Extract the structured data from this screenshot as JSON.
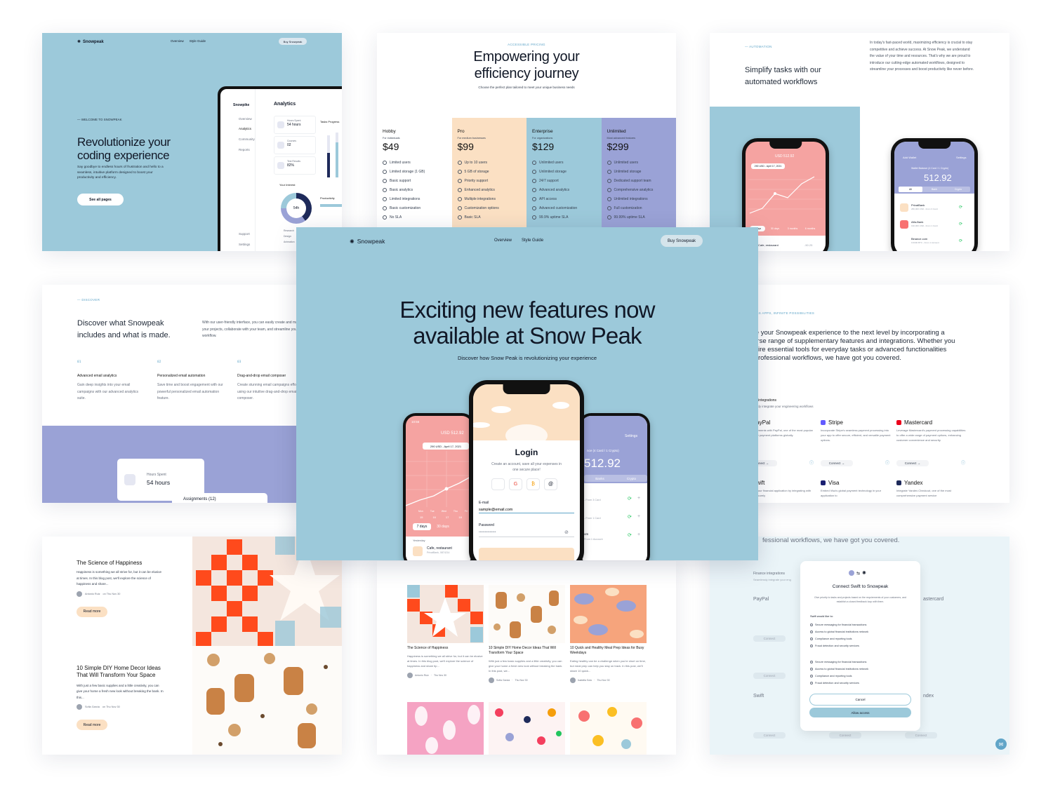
{
  "colors": {
    "blue": "#9cc9da",
    "peach": "#fbe0c3",
    "lavender": "#9aa2d6",
    "coral": "#f5a3a1",
    "dark": "#111827"
  },
  "hero_card": {
    "logo": "Snowpeak",
    "nav": [
      "Overview",
      "Style Guide"
    ],
    "cta": "Buy Snowpeak",
    "eyebrow": "— WELCOME TO SNOWPEAK",
    "title_l1": "Revolutionize your",
    "title_l2": "coding experience",
    "subtitle": "Say goodbye to endless hours of frustration and hello to a seamless, intuitive platform designed to boost your productivity and efficiency.",
    "button": "See all pages",
    "app": {
      "brand": "Snowpike",
      "title": "Analytics",
      "menu": [
        "Overview",
        "Analytics",
        "Community",
        "Reports"
      ],
      "footer": [
        "Support",
        "Settings"
      ],
      "stats": [
        {
          "label": "Hours Spent",
          "value": "54 hours"
        },
        {
          "label": "Courses",
          "value": "02"
        },
        {
          "label": "Test Results",
          "value": "82%"
        }
      ],
      "tasks_title": "Tasks Progress",
      "interest_title": "Your Interest",
      "donut_value": "54h",
      "legend": [
        "Research",
        "Design",
        "Animation"
      ],
      "productivity": "Productivity"
    }
  },
  "pricing": {
    "eyebrow": "ACCESSIBLE PRICING",
    "title_l1": "Empowering your",
    "title_l2": "efficiency journey",
    "subtitle": "Choose the perfect plan tailored to meet your unique business needs",
    "plans": [
      {
        "name": "Hobby",
        "for": "For individuals",
        "price": "$49",
        "features": [
          "Limited users",
          "Limited storage (1 GB)",
          "Basic support",
          "Basic analytics",
          "Limited integrations",
          "Basic customization",
          "No SLA"
        ]
      },
      {
        "name": "Pro",
        "for": "For medium businesses",
        "price": "$99",
        "features": [
          "Up to 10 users",
          "5 GB of storage",
          "Priority support",
          "Enhanced analytics",
          "Multiple integrations",
          "Customization options",
          "Basic SLA"
        ]
      },
      {
        "name": "Enterprise",
        "for": "For organizations",
        "price": "$129",
        "features": [
          "Unlimited users",
          "Unlimited storage",
          "24/7 support",
          "Advanced analytics",
          "API access",
          "Advanced customization",
          "99.9% uptime SLA"
        ]
      },
      {
        "name": "Unlimited",
        "for": "Most advanced features",
        "price": "$299",
        "features": [
          "Unlimited users",
          "Unlimited storage",
          "Dedicated support team",
          "Comprehensive analytics",
          "Unlimited integrations",
          "Full customization",
          "99.99% uptime SLA"
        ]
      }
    ]
  },
  "automation": {
    "eyebrow": "— AUTOMATION",
    "title_l1": "Simplify tasks with our",
    "title_l2": "automated workflows",
    "body": "In today's fast-paced world, maximizing efficiency is crucial to stay competitive and achieve success. At Snow Peak, we understand the value of your time and resources. That's why we are proud to introduce our cutting-edge automated workflows, designed to streamline your processes and boost productivity like never before.",
    "phone1": {
      "amount": "USD 512.92",
      "tooltip": "290 USD - April 17, 2021",
      "tabs": [
        "7 days",
        "30 days",
        "3 months",
        "6 months"
      ],
      "item": "Cafe, restaurant",
      "item_amt": "-50.25"
    },
    "phone2": {
      "header": "Add Wallet",
      "settings": "Settings",
      "label": "Wallet Balance (4 Card / 1 Crypto)",
      "amount": "512.92",
      "tabs": [
        "All",
        "Bank",
        "Crypto"
      ],
      "items": [
        {
          "name": "PrivatBank",
          "sub": "280,000 USD - From 3 Card"
        },
        {
          "name": "Alfa-Bank",
          "sub": "190,000 USD - From 1 Card"
        },
        {
          "name": "Binance.com",
          "sub": "0.6000 BTC - From 1 Account"
        }
      ]
    }
  },
  "discover": {
    "eyebrow": "— DISCOVER",
    "title_l1": "Discover what Snowpeak",
    "title_l2": "includes and what is made.",
    "body": "With our user-friendly interface, you can easily create and manage your projects, collaborate with your team, and streamline your workflow.",
    "features": [
      {
        "num": "01",
        "title": "Advanced email analytics",
        "desc": "Gain deep insights into your email campaigns with our advanced analytics suite."
      },
      {
        "num": "02",
        "title": "Personalized email automation",
        "desc": "Save time and boost engagement with our powerful personalized email automation feature."
      },
      {
        "num": "03",
        "title": "Drag-and-drop email composer",
        "desc": "Create stunning email campaigns effortlessly using our intuitive drag-and-drop email composer."
      }
    ],
    "stat_label": "Hours Spent",
    "stat_value": "54 hours",
    "assign": "Assignments (12)"
  },
  "integrations": {
    "eyebrow": "ENDLESS APPS, INFINITE POSSIBILITIES",
    "body": "Take your Snowpeak experience to the next level by incorporating a diverse range of supplementary features and integrations. Whether you require essential tools for everyday tasks or advanced functionalities for professional workflows, we have got you covered.",
    "section": "Finance integrations",
    "section_sub": "Seamlessly integrate your engineering workflows",
    "connect": "Connect",
    "items": [
      {
        "name": "PayPal",
        "desc": "Accept payments with PayPal, one of the most popular and secure payment platforms globally."
      },
      {
        "name": "Stripe",
        "desc": "Incorporate Stripe's seamless payment processing into your app to offer secure, efficient, and versatile payment options."
      },
      {
        "name": "Mastercard",
        "desc": "Leverage Mastercard's payment processing capabilities to offer a wide range of payment options, enhancing customer convenience and security."
      },
      {
        "name": "Swift",
        "desc": "Enhance your financial application by integrating with Swift to securely"
      },
      {
        "name": "Visa",
        "desc": "Embed Visa's global payment technology in your application to"
      },
      {
        "name": "Yandex",
        "desc": "Integrate Yandex.Checkout, one of the most comprehensive payment service"
      }
    ]
  },
  "featured": {
    "logo": "Snowpeak",
    "nav": [
      "Overview",
      "Style Guide"
    ],
    "cta": "Buy Snowpeak",
    "title_l1": "Exciting new features now",
    "title_l2": "available at Snow Peak",
    "subtitle": "Discover how Snow Peak is revolutionizing your experience",
    "login": {
      "title": "Login",
      "sub": "Create an account, save all your expenses in one secure place!",
      "email_label": "E-mail",
      "email_value": "sample@email.com",
      "password_label": "Password",
      "password_value": "••••••••••••••"
    },
    "left_phone": {
      "time": "10:56",
      "amount": "USD 512.92",
      "tooltip": "290 USD - April 17, 2021",
      "days": [
        "Mon",
        "Tue",
        "Wed",
        "Thu",
        "Fri"
      ],
      "dates": [
        "15",
        "16",
        "17",
        "18",
        "19"
      ],
      "tabs": [
        "7 days",
        "30 days"
      ],
      "yesterday": "Yesterday",
      "item": "Cafe, restaurant",
      "item_sub": "PrivatBank, 0874214"
    },
    "right_phone": {
      "settings": "Settings",
      "label": "nce (4 Card / 1 Crypto)",
      "amount": "512.92",
      "tabs": [
        "Banks",
        "Crypto"
      ],
      "rows": [
        "- From 3 Card",
        "- From 1 Card",
        "om",
        "From 1 Account"
      ]
    }
  },
  "blog": {
    "posts": [
      {
        "title": "The Science of Happiness",
        "excerpt": "Happiness is something we all strive for, but it can be elusive at times. In this blog post, we'll explore the science of happiness and share...",
        "author": "Antonio Ruiz",
        "date": "on Thu Nov 30",
        "button": "Read more"
      },
      {
        "title": "10 Simple DIY Home Decor Ideas That Will Transform Your Space",
        "excerpt": "With just a few basic supplies and a little creativity, you can give your home a fresh new look without breaking the bank. In this...",
        "author": "Sofia Garcia",
        "date": "on Thu Nov 30",
        "button": "Read more"
      }
    ]
  },
  "blog_grid": {
    "posts": [
      {
        "title": "The Science of Happiness",
        "excerpt": "Happiness is something we all strive for, but it can be elusive at times. In this blog post, we'll explore the science of happiness and share tip...",
        "author": "Antonio Ruiz",
        "date": "Thu Nov 30"
      },
      {
        "title": "10 Simple DIY Home Decor Ideas That Will Transform Your Space",
        "excerpt": "With just a few basic supplies and a little creativity, you can give your home a fresh new look without breaking the bank. In this post, we...",
        "author": "Sofia Garcia",
        "date": "Thu Nov 30"
      },
      {
        "title": "10 Quick and Healthy Meal Prep Ideas for Busy Weekdays",
        "excerpt": "Eating healthy can be a challenge when you're short on time, but meal prep can help you stay on track. In this post, we'll share 10 quick...",
        "author": "Isabella Soto",
        "date": "Thu Nov 30"
      }
    ]
  },
  "modal_card": {
    "bg_text": "fessional workflows, we have got you covered.",
    "section": "Finance integrations",
    "section_sub": "Seamlessly integrate your eng",
    "bg_items": [
      "PayPal",
      "astercard",
      "Swift",
      "ndex"
    ],
    "connect": "Connect",
    "modal": {
      "title": "Connect Swift to Snowpeak",
      "desc": "Give priority to tasks and projects based on the requirements of your customers, and establish a closed feedback loop with them.",
      "list_title": "Swift would like to:",
      "perms_a": [
        "Secure messaging for financial transactions",
        "Access to global financial institutions network",
        "Compliance and reporting tools",
        "Fraud detection and security services"
      ],
      "perms_b": [
        "Secure messaging for financial transactions",
        "Access to global financial institutions network",
        "Compliance and reporting tools",
        "Fraud detection and security services"
      ],
      "cancel": "Cancel",
      "allow": "Allow access"
    }
  }
}
